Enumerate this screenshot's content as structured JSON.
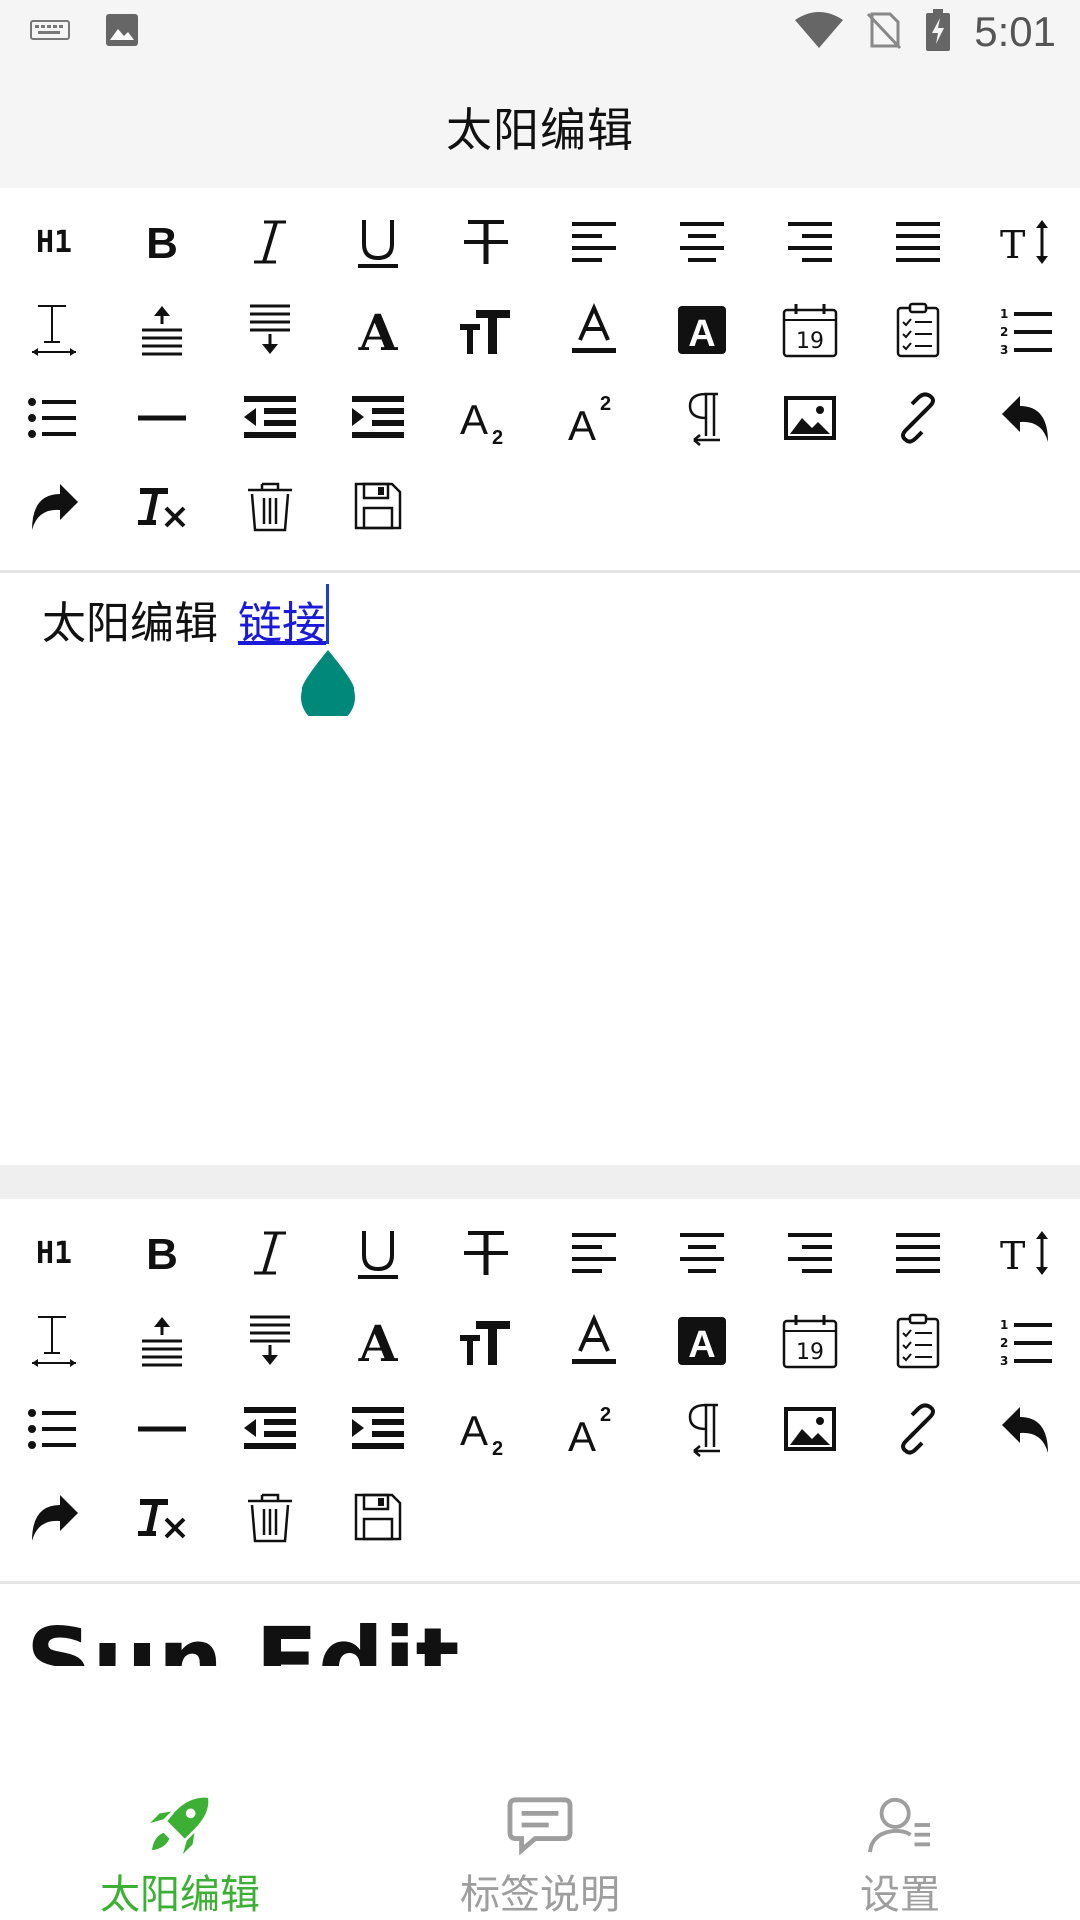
{
  "status_bar": {
    "time": "5:01",
    "icons": [
      "keyboard-icon",
      "image-icon",
      "wifi-icon",
      "no-sim-icon",
      "battery-charging-icon"
    ]
  },
  "app_bar": {
    "title": "太阳编辑"
  },
  "toolbar": {
    "h1_label": "H1",
    "bold_label": "B",
    "italic_label": "I",
    "underline_label": "U",
    "font_size_label": "A",
    "text_color_label": "A",
    "bg_color_label": "A",
    "subscript_label": "A",
    "superscript_label": "A",
    "calendar_day": "19",
    "icons": [
      "h1-icon",
      "bold-icon",
      "italic-icon",
      "underline-icon",
      "strikethrough-icon",
      "align-left-icon",
      "align-center-icon",
      "align-right-icon",
      "align-justify-icon",
      "text-height-icon",
      "text-width-icon",
      "line-spacing-up-icon",
      "line-spacing-down-icon",
      "font-icon",
      "font-size-icon",
      "text-color-icon",
      "background-color-icon",
      "calendar-icon",
      "clipboard-checklist-icon",
      "ordered-list-icon",
      "unordered-list-icon",
      "horizontal-rule-icon",
      "outdent-icon",
      "indent-icon",
      "subscript-icon",
      "superscript-icon",
      "paragraph-icon",
      "image-icon",
      "link-icon",
      "undo-icon",
      "redo-icon",
      "clear-format-icon",
      "delete-icon",
      "save-icon"
    ]
  },
  "editor": {
    "plain_text": "太阳编辑",
    "link_text": "链接"
  },
  "preview": {
    "title": "Sun Edit"
  },
  "bottom_nav": {
    "accent": "#3cb034",
    "inactive": "#9e9e9e",
    "items": [
      {
        "label": "太阳编辑",
        "active": true
      },
      {
        "label": "标签说明",
        "active": false
      },
      {
        "label": "设置",
        "active": false
      }
    ]
  }
}
